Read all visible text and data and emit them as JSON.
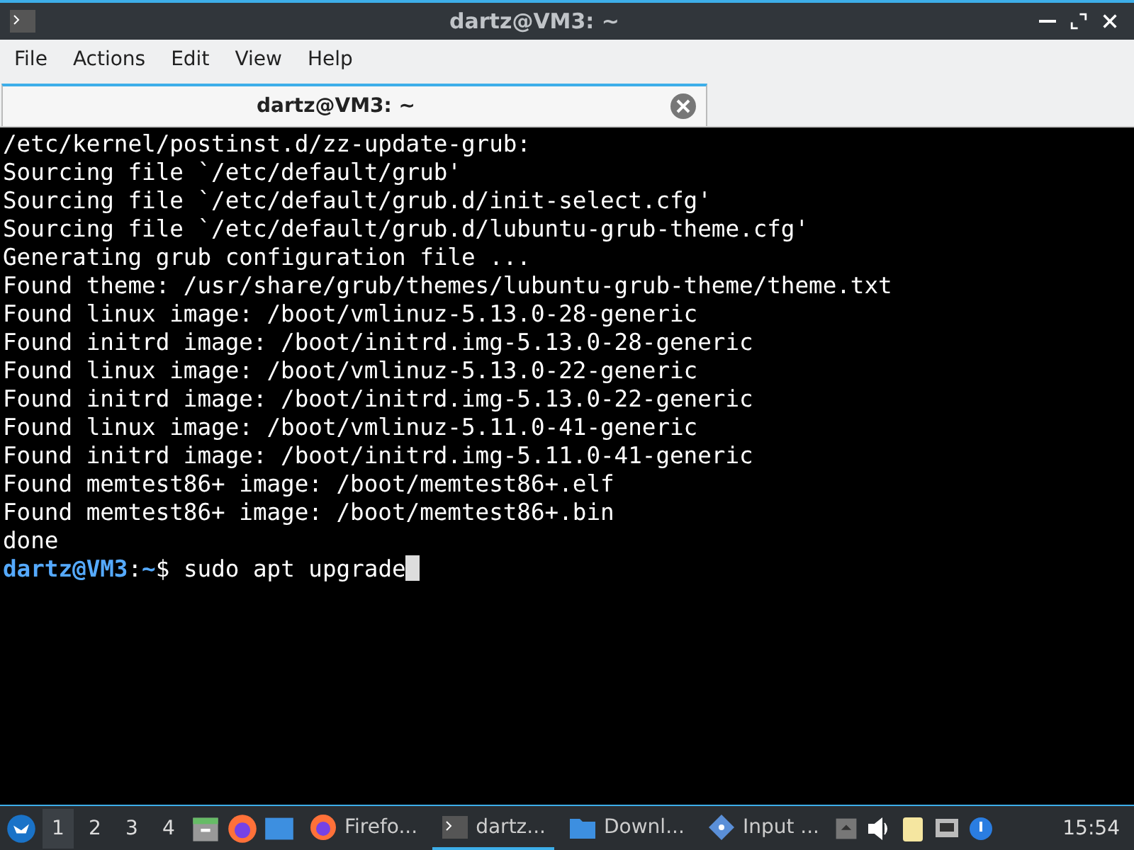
{
  "window": {
    "title": "dartz@VM3: ~"
  },
  "menu": [
    "File",
    "Actions",
    "Edit",
    "View",
    "Help"
  ],
  "tabs": [
    {
      "label": "dartz@VM3: ~",
      "selected": true
    }
  ],
  "terminal": {
    "lines": [
      "/etc/kernel/postinst.d/zz-update-grub:",
      "Sourcing file `/etc/default/grub'",
      "Sourcing file `/etc/default/grub.d/init-select.cfg'",
      "Sourcing file `/etc/default/grub.d/lubuntu-grub-theme.cfg'",
      "Generating grub configuration file ...",
      "Found theme: /usr/share/grub/themes/lubuntu-grub-theme/theme.txt",
      "Found linux image: /boot/vmlinuz-5.13.0-28-generic",
      "Found initrd image: /boot/initrd.img-5.13.0-28-generic",
      "Found linux image: /boot/vmlinuz-5.13.0-22-generic",
      "Found initrd image: /boot/initrd.img-5.13.0-22-generic",
      "Found linux image: /boot/vmlinuz-5.11.0-41-generic",
      "Found initrd image: /boot/initrd.img-5.11.0-41-generic",
      "Found memtest86+ image: /boot/memtest86+.elf",
      "Found memtest86+ image: /boot/memtest86+.bin",
      "done"
    ],
    "prompt": {
      "user_host": "dartz@VM3",
      "separator": ":",
      "path": "~",
      "symbol": "$",
      "command": "sudo apt upgrade"
    }
  },
  "taskbar": {
    "workspaces": [
      {
        "label": "1",
        "selected": true
      },
      {
        "label": "2",
        "selected": false
      },
      {
        "label": "3",
        "selected": false
      },
      {
        "label": "4",
        "selected": false
      }
    ],
    "windows": [
      {
        "kind": "firefox",
        "label": "Firefo...",
        "selected": false
      },
      {
        "kind": "terminal",
        "label": "dartz...",
        "selected": true
      },
      {
        "kind": "folder",
        "label": "Downl...",
        "selected": false
      },
      {
        "kind": "input",
        "label": "Input ...",
        "selected": false
      }
    ],
    "clock": "15:54"
  }
}
